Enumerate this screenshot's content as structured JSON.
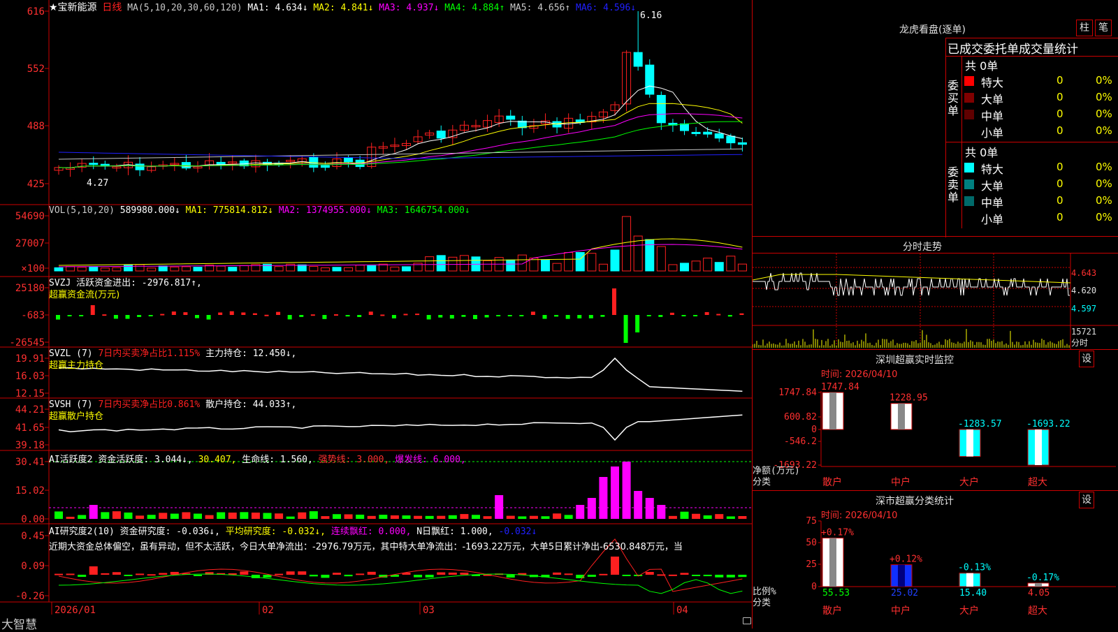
{
  "stock": {
    "name": "★宝新能源",
    "period": "日线"
  },
  "main_panel": {
    "ma_label": "MA(5,10,20,30,60,120)",
    "ma_items": [
      {
        "text": "MA1: 4.634↓",
        "color": "#ffffff"
      },
      {
        "text": "MA2: 4.841↓",
        "color": "#ffff00"
      },
      {
        "text": "MA3: 4.937↓",
        "color": "#ff00ff"
      },
      {
        "text": "MA4: 4.884↑",
        "color": "#00ff00"
      },
      {
        "text": "MA5: 4.656↑",
        "color": "#c8c8c8"
      },
      {
        "text": "MA6: 4.596↓",
        "color": "#2020ff"
      }
    ],
    "y_ticks": [
      "616",
      "552",
      "488",
      "425"
    ],
    "high_label": "6.16",
    "low_label": "4.27"
  },
  "vol_panel": {
    "label": "VOL(5,10,20)",
    "items": [
      {
        "text": "589980.000↓",
        "color": "#ffffff"
      },
      {
        "text": "MA1: 775814.812↓",
        "color": "#ffff00"
      },
      {
        "text": "MA2: 1374955.000↓",
        "color": "#ff00ff"
      },
      {
        "text": "MA3: 1646754.000↓",
        "color": "#00ff00"
      }
    ],
    "y_ticks": [
      "54690",
      "27007",
      "×100"
    ]
  },
  "svzj_panel": {
    "label": "SVZJ  活跃资金进出: -2976.817↑,",
    "sub": "超赢资金流(万元)",
    "y_ticks": [
      "25180",
      "-683",
      "-26545"
    ]
  },
  "svzl_panel": {
    "label": "SVZL (7)",
    "pct": "7日内买卖净占比1.115%",
    "hold": "主力持仓: 12.450↓,",
    "sub": "超赢主力持仓",
    "y_ticks": [
      "19.91",
      "16.03",
      "12.15"
    ]
  },
  "svsh_panel": {
    "label": "SVSH (7)",
    "pct": "7日内买卖净占比0.861%",
    "hold": "散户持仓: 44.033↑,",
    "sub": "超赢散户持仓",
    "y_ticks": [
      "44.21",
      "41.65",
      "39.18"
    ]
  },
  "ai_active_panel": {
    "label": "AI活跃度2",
    "items": [
      {
        "text": "资金活跃度: 3.044↓,",
        "color": "#ffffff"
      },
      {
        "text": "30.407,",
        "color": "#ffff00"
      },
      {
        "text": "生命线: 1.560,",
        "color": "#ffffff"
      },
      {
        "text": "强势线: 3.000,",
        "color": "#ff3030"
      },
      {
        "text": "爆发线: 6.000,",
        "color": "#ff00ff"
      }
    ],
    "y_ticks": [
      "30.41",
      "15.02",
      "0.00"
    ]
  },
  "ai_research_panel": {
    "label": "AI研究度2(10)",
    "items": [
      {
        "text": "资金研究度: -0.036↓,",
        "color": "#ffffff"
      },
      {
        "text": "平均研究度: -0.032↓,",
        "color": "#ffff00"
      },
      {
        "text": "连续飘红: 0.000,",
        "color": "#ff00ff"
      },
      {
        "text": "N日飘红: 1.000,",
        "color": "#ffffff"
      },
      {
        "text": "-0.032↓",
        "color": "#2020ff"
      }
    ],
    "comment": "近期大资金总体偏空，虽有异动，但不太活跃，今日大单净流出：-2976.79万元，其中特大单净流出：-1693.22万元，大单5日累计净出-6530.848万元，当",
    "y_ticks": [
      "0.45",
      "0.09",
      "-0.26"
    ]
  },
  "x_axis": {
    "labels": [
      "2026/01",
      "02",
      "03",
      "04"
    ]
  },
  "brand": "大智慧",
  "right": {
    "lhb": {
      "title": "龙虎看盘(逐单)",
      "btn_bar": "柱",
      "btn_detail": "笔"
    },
    "order_stats": {
      "header": "已成交委托单成交量统计",
      "buy": {
        "side": "委买单",
        "total": "共 0单",
        "rows": [
          {
            "label": "特大",
            "count": "0",
            "pct": "0%",
            "color": "#ff0000"
          },
          {
            "label": "大单",
            "count": "0",
            "pct": "0%",
            "color": "#800000"
          },
          {
            "label": "中单",
            "count": "0",
            "pct": "0%",
            "color": "#600000"
          },
          {
            "label": "小单",
            "count": "0",
            "pct": "0%",
            "color": ""
          }
        ]
      },
      "sell": {
        "side": "委卖单",
        "total": "共 0单",
        "rows": [
          {
            "label": "特大",
            "count": "0",
            "pct": "0%",
            "color": "#00ffff"
          },
          {
            "label": "大单",
            "count": "0",
            "pct": "0%",
            "color": "#008080"
          },
          {
            "label": "中单",
            "count": "0",
            "pct": "0%",
            "color": "#006a6a"
          },
          {
            "label": "小单",
            "count": "0",
            "pct": "0%",
            "color": ""
          }
        ]
      }
    },
    "intraday": {
      "title": "分时走势",
      "prices": [
        "4.643",
        "4.620",
        "4.597"
      ],
      "vol_tick": "15721",
      "vol_unit": "分时"
    },
    "sz_monitor": {
      "title": "深圳超赢实时监控",
      "btn": "设",
      "time": "时间: 2026/04/10",
      "y_ticks": [
        "1747.84",
        "600.82",
        "0",
        "-546.2",
        "-1693.22"
      ],
      "ylabel": "净额(万元)",
      "xlabel": "分类",
      "bars": [
        {
          "cat": "散户",
          "value": 1747.84,
          "label": "1747.84"
        },
        {
          "cat": "中户",
          "value": 1228.95,
          "label": "1228.95"
        },
        {
          "cat": "大户",
          "value": -1283.57,
          "label": "-1283.57"
        },
        {
          "cat": "超大",
          "value": -1693.22,
          "label": "-1693.22"
        }
      ]
    },
    "sz_class": {
      "title": "深市超赢分类统计",
      "btn": "设",
      "time": "时间: 2026/04/10",
      "y_ticks": [
        "75",
        "50",
        "25",
        "0"
      ],
      "ylabel": "比例%",
      "xlabel": "分类",
      "bars": [
        {
          "cat": "散户",
          "value": 55.53,
          "label": "55.53",
          "delta": "+0.17%"
        },
        {
          "cat": "中户",
          "value": 25.02,
          "label": "25.02",
          "delta": "+0.12%"
        },
        {
          "cat": "大户",
          "value": 15.4,
          "label": "15.40",
          "delta": "-0.13%"
        },
        {
          "cat": "超大",
          "value": 4.05,
          "label": "4.05",
          "delta": "-0.17%"
        }
      ]
    }
  },
  "chart_data": {
    "type": "bar",
    "title": "深圳超赢实时监控",
    "categories": [
      "散户",
      "中户",
      "大户",
      "超大"
    ],
    "series": [
      {
        "values": [
          1747.84,
          1228.95,
          -1283.57,
          -1693.22
        ]
      }
    ],
    "ylabel": "净额(万元)",
    "ylim": [
      -1693.22,
      1747.84
    ]
  }
}
